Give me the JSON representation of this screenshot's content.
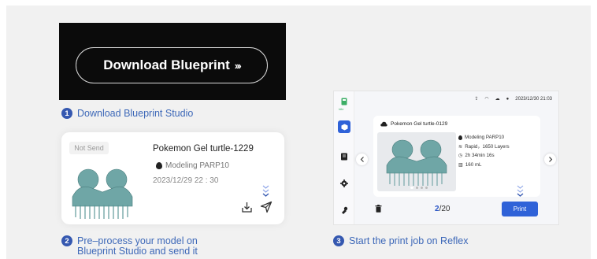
{
  "colors": {
    "accent": "#3558b0",
    "step_text": "#3d68b8",
    "print_button": "#2f62d8",
    "model": "#6fa6a6"
  },
  "step1": {
    "number": "1",
    "banner_button": "Download Blueprint",
    "banner_arrows": "›››",
    "caption": "Download Blueprint Studio"
  },
  "step2": {
    "number": "2",
    "card": {
      "badge": "Not Send",
      "title": "Pokemon Gel turtle-1229",
      "modeling": "Modeling PARP10",
      "date": "2023/12/29 22 : 30",
      "icons": [
        "chevron-down-double-icon",
        "download-icon",
        "send-icon",
        "droplet-icon"
      ]
    },
    "caption_line1": "Pre–process your model on",
    "caption_line2": "Blueprint Studio and send it"
  },
  "step3": {
    "number": "3",
    "caption": "Start the print job on Reflex",
    "device": {
      "sidebar_badge": "Idle",
      "status_time": "2023/12/30  21:03",
      "job_title": "Pokemon Gel turtle-0129",
      "modeling": "Modeling PARP10",
      "mode": "Rapid，1650 Layers",
      "duration": "2h 34min 16s",
      "volume": "160 mL",
      "page_current": "2",
      "page_total": "/20",
      "print_label": "Print"
    }
  }
}
